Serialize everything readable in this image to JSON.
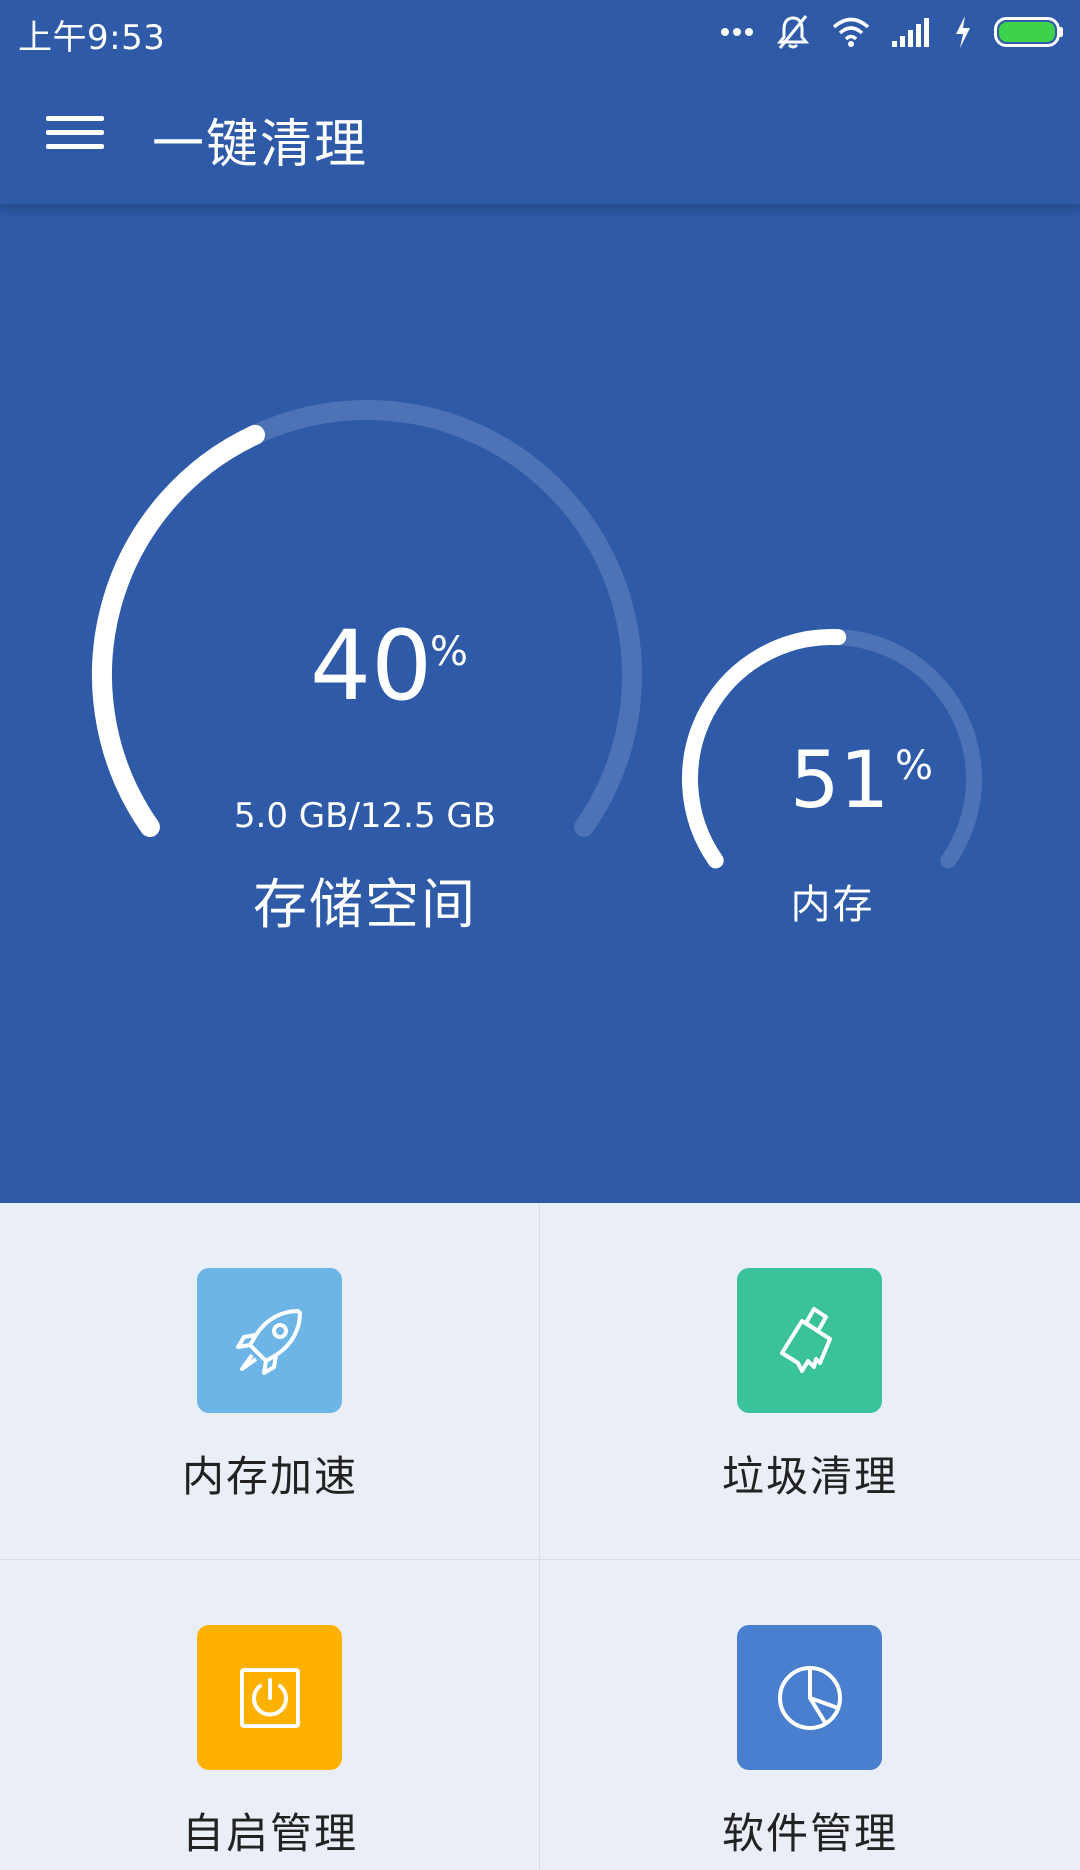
{
  "status": {
    "time": "上午9:53",
    "icons": [
      "more-dots-icon",
      "notifications-off-icon",
      "wifi-icon",
      "signal-icon",
      "charging-icon",
      "battery-icon"
    ]
  },
  "appbar": {
    "title": "一键清理",
    "menu_icon": "menu-icon"
  },
  "storage": {
    "percent": "40",
    "percent_sign": "%",
    "size": "5.0 GB/12.5 GB",
    "label": "存储空间",
    "value": 40
  },
  "memory": {
    "percent": "51",
    "percent_sign": "%",
    "label": "内存",
    "value": 51
  },
  "tools": [
    {
      "label": "内存加速",
      "icon": "rocket-icon",
      "color": "#6cb5e6"
    },
    {
      "label": "垃圾清理",
      "icon": "broom-icon",
      "color": "#3ac39a"
    },
    {
      "label": "自启管理",
      "icon": "power-icon",
      "color": "#ffb100"
    },
    {
      "label": "软件管理",
      "icon": "pie-chart-icon",
      "color": "#4a7fcf"
    }
  ],
  "colors": {
    "primary": "#2e5aa8",
    "grid_bg": "#eaeef6"
  }
}
